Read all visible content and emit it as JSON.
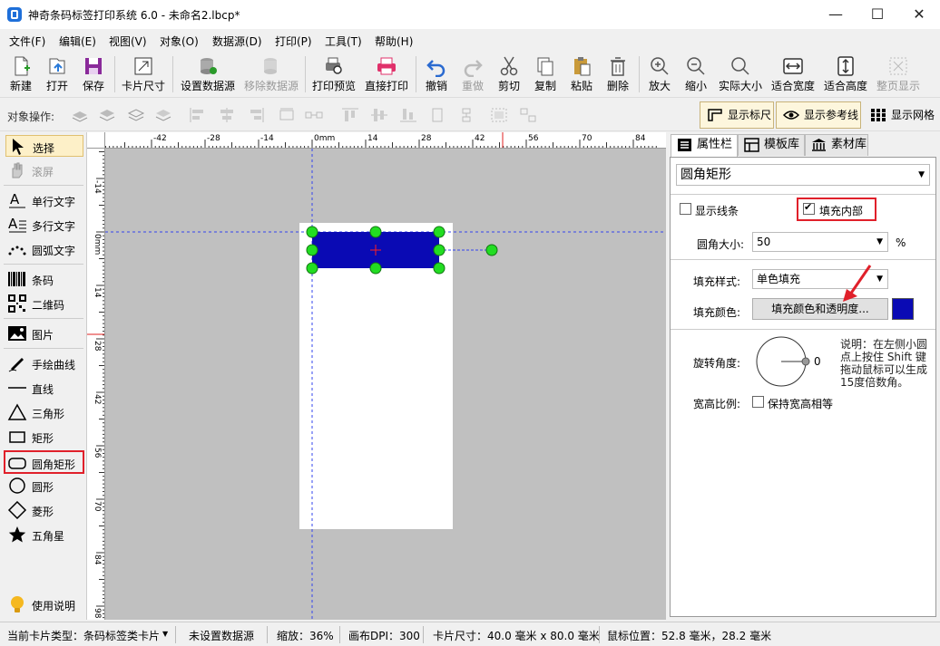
{
  "window": {
    "title": "神奇条码标签打印系统 6.0 - 未命名2.lbcp*",
    "minimize": "—",
    "maximize": "☐",
    "close": "✕"
  },
  "menu": [
    "文件(F)",
    "编辑(E)",
    "视图(V)",
    "对象(O)",
    "数据源(D)",
    "打印(P)",
    "工具(T)",
    "帮助(H)"
  ],
  "toolbar": {
    "new": "新建",
    "open": "打开",
    "save": "保存",
    "card_size": "卡片尺寸",
    "set_datasource": "设置数据源",
    "remove_datasource": "移除数据源",
    "print_preview": "打印预览",
    "direct_print": "直接打印",
    "undo": "撤销",
    "redo": "重做",
    "cut": "剪切",
    "copy": "复制",
    "paste": "粘贴",
    "delete": "删除",
    "zoom_in": "放大",
    "zoom_out": "缩小",
    "actual_size": "实际大小",
    "fit_width": "适合宽度",
    "fit_height": "适合高度",
    "full_page": "整页显示"
  },
  "opsbar": {
    "label": "对象操作:",
    "show_ruler": "显示标尺",
    "show_guides": "显示参考线",
    "show_grid": "显示网格"
  },
  "tools": {
    "select": "选择",
    "scroll": "滚屏",
    "single_text": "单行文字",
    "multi_text": "多行文字",
    "arc_text": "圆弧文字",
    "barcode": "条码",
    "qrcode": "二维码",
    "image": "图片",
    "freehand": "手绘曲线",
    "line": "直线",
    "triangle": "三角形",
    "rectangle": "矩形",
    "rounded_rect": "圆角矩形",
    "circle": "圆形",
    "diamond": "菱形",
    "star": "五角星",
    "help": "使用说明"
  },
  "ruler": {
    "h_ticks": [
      "-42",
      "-28",
      "-14",
      "0mm",
      "14",
      "28",
      "42",
      "56",
      "70",
      "84"
    ],
    "v_ticks": [
      "-14",
      "0mm",
      "14",
      "28",
      "42",
      "56",
      "70",
      "84",
      "98"
    ]
  },
  "right_tabs": [
    "属性栏",
    "模板库",
    "素材库"
  ],
  "props": {
    "object_type": "圆角矩形",
    "show_line_label": "显示线条",
    "show_line_checked": false,
    "fill_inside_label": "填充内部",
    "fill_inside_checked": true,
    "corner_label": "圆角大小:",
    "corner_value": "50",
    "corner_unit": "%",
    "fill_style_label": "填充样式:",
    "fill_style_value": "单色填充",
    "fill_color_label": "填充颜色:",
    "fill_color_button": "填充颜色和透明度...",
    "fill_color": "#0a0ab4",
    "rotation_label": "旋转角度:",
    "rotation_value": "0",
    "rotation_note": [
      "说明：在左侧小圆",
      "点上按住 Shift 键",
      "拖动鼠标可以生成",
      "15度倍数角。"
    ],
    "aspect_label": "宽高比例:",
    "keep_aspect_label": "保持宽高相等",
    "keep_aspect_checked": false
  },
  "status": {
    "card_type": "当前卡片类型：条码标签类卡片",
    "datasource": "未设置数据源",
    "zoom": "缩放：36%",
    "dpi": "画布DPI：300",
    "card_size": "卡片尺寸：40.0 毫米 x 80.0 毫米",
    "mouse_pos": "鼠标位置：52.8 毫米，28.2 毫米"
  },
  "colors": {
    "shape_fill": "#0a0ab4",
    "handle": "#22dd22",
    "highlight": "#e0202a",
    "guide": "#3344ee"
  }
}
